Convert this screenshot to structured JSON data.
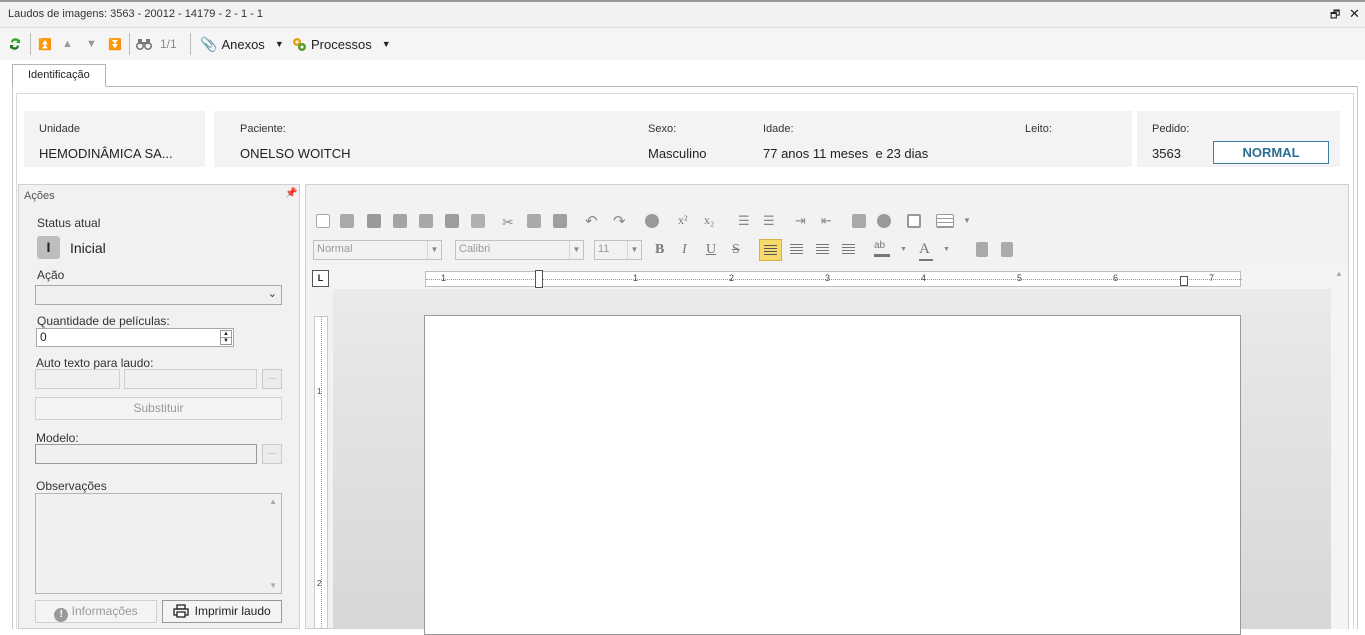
{
  "window": {
    "title": "Laudos de imagens: 3563 - 20012 - 14179 - 2 - 1 - 1",
    "restore_glyph": "🗗",
    "close_glyph": "✕"
  },
  "toolbar": {
    "counter": "1/1",
    "anexos": "Anexos",
    "processos": "Processos"
  },
  "tabs": {
    "identificacao": "Identificação"
  },
  "header": {
    "unidade_label": "Unidade",
    "unidade": "HEMODINÂMICA SA...",
    "paciente_label": "Paciente:",
    "paciente": "ONELSO WOITCH",
    "sexo_label": "Sexo:",
    "sexo": "Masculino",
    "idade_label": "Idade:",
    "idade": "77 anos 11 meses  e 23 dias",
    "leito_label": "Leito:",
    "leito": "",
    "pedido_label": "Pedido:",
    "pedido": "3563",
    "prioridade": "NORMAL"
  },
  "acoes": {
    "title": "Ações",
    "status_label": "Status atual",
    "status_letter": "I",
    "status": "Inicial",
    "acao_label": "Ação",
    "acao_value": "",
    "qtd_label": "Quantidade de películas:",
    "qtd_value": "0",
    "autotexto_label": "Auto texto para laudo:",
    "substituir": "Substituir",
    "modelo_label": "Modelo:",
    "obs_label": "Observações",
    "informacoes": "Informações",
    "imprimir": "Imprimir laudo"
  },
  "editor": {
    "style": "Normal",
    "font": "Calibri",
    "size": "11",
    "bold": "B",
    "italic": "I",
    "underline": "U",
    "strike": "S",
    "superscript": "x²",
    "subscript": "x₂",
    "highlight": "ab",
    "fontcolor": "A",
    "ruler_tab": "L",
    "ruler_numbers": [
      "1",
      "1",
      "2",
      "3",
      "4",
      "5",
      "6",
      "7"
    ],
    "vruler_numbers": [
      "1",
      "2"
    ]
  },
  "colors": {
    "accent": "#2b6e92",
    "refresh": "#2aa52a",
    "highlight": "#f7d96b"
  }
}
